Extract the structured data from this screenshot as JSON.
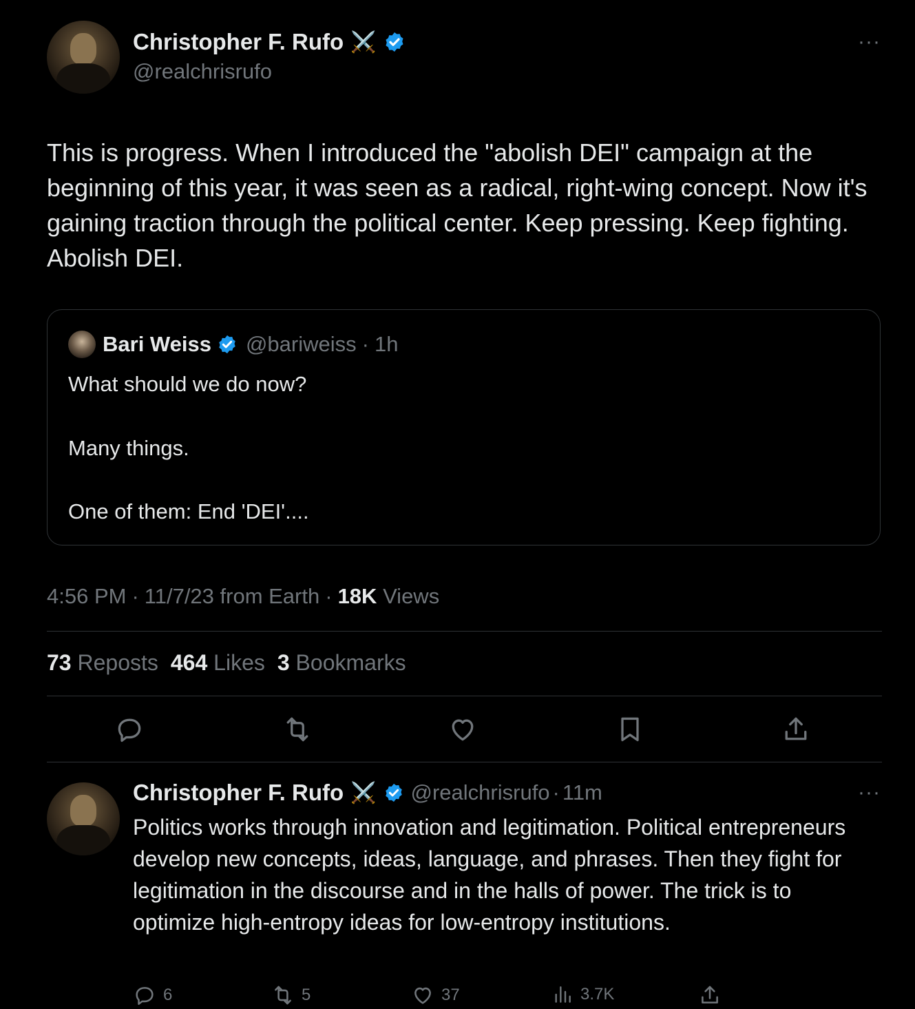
{
  "tweet": {
    "author_name": "Christopher F. Rufo",
    "author_emoji": "⚔️",
    "author_handle": "@realchrisrufo",
    "more_label": "···",
    "text": "This is progress. When I introduced the \"abolish DEI\" campaign at the beginning of this year, it was seen as a radical, right-wing concept. Now it's gaining traction through the political center. Keep pressing. Keep fighting. Abolish DEI.",
    "quote": {
      "author_name": "Bari Weiss",
      "author_handle": "@bariweiss",
      "separator": "·",
      "time": "1h",
      "line1": "What should we do now?",
      "line2": "Many things.",
      "line3": "One of them: End 'DEI'...."
    },
    "meta": {
      "time": "4:56 PM",
      "sep1": "·",
      "date_source": "11/7/23 from Earth",
      "sep2": "·",
      "views_count": "18K",
      "views_label": "Views"
    },
    "stats": {
      "reposts_count": "73",
      "reposts_label": "Reposts",
      "likes_count": "464",
      "likes_label": "Likes",
      "bookmarks_count": "3",
      "bookmarks_label": "Bookmarks"
    },
    "actions": [
      "reply-icon",
      "repost-icon",
      "like-icon",
      "bookmark-icon",
      "share-icon"
    ]
  },
  "reply": {
    "author_name": "Christopher F. Rufo",
    "author_emoji": "⚔️",
    "author_handle": "@realchrisrufo",
    "separator": "·",
    "time": "11m",
    "more_label": "···",
    "text": "Politics works through innovation and legitimation. Political entrepreneurs develop new concepts, ideas, language, and phrases. Then they fight for legitimation in the discourse and in the halls of power. The trick is to optimize high-entropy ideas for low-entropy institutions.",
    "replies": "6",
    "reposts": "5",
    "likes": "37",
    "views": "3.7K"
  },
  "colors": {
    "background": "#000000",
    "text": "#e7e9ea",
    "muted": "#71767b",
    "border": "#2f3336",
    "verified": "#1d9bf0"
  }
}
